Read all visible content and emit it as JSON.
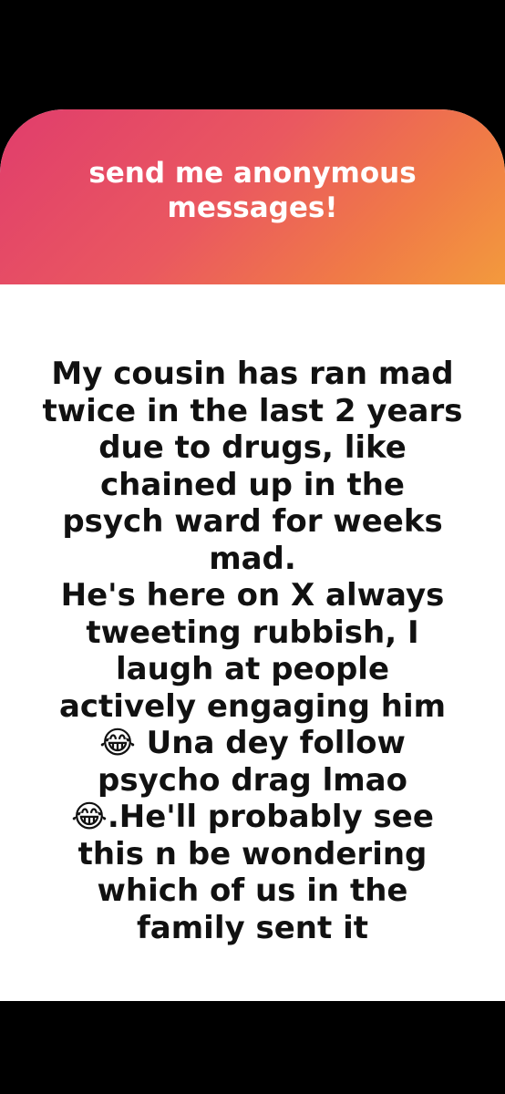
{
  "card": {
    "title": "send me anonymous messages!",
    "message_lines": [
      "My cousin has ran mad",
      "twice in the last 2 years",
      "due to drugs, like",
      "chained up in the",
      "psych ward for weeks",
      "mad.",
      "He's here on X always",
      "tweeting rubbish, I",
      "laugh at people",
      "actively engaging him",
      "😂 Una dey follow",
      "psycho drag lmao",
      "😂.He'll probably see",
      "this n be wondering",
      "which of us in the",
      "family sent it"
    ]
  },
  "colors": {
    "gradient_start": "#e03d6c",
    "gradient_end": "#f39a3d",
    "background": "#000000",
    "card": "#ffffff",
    "text": "#111111"
  }
}
